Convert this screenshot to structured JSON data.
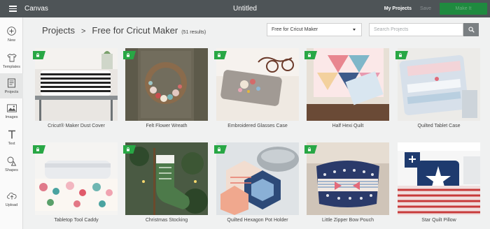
{
  "topbar": {
    "app_title": "Canvas",
    "doc_title": "Untitled",
    "my_projects": "My Projects",
    "save": "Save",
    "make_it": "Make It"
  },
  "sidebar": {
    "items": [
      {
        "label": "New",
        "icon": "plus-icon"
      },
      {
        "label": "Templates",
        "icon": "shirt-icon"
      },
      {
        "label": "Projects",
        "icon": "projects-icon"
      },
      {
        "label": "Images",
        "icon": "image-icon"
      },
      {
        "label": "Text",
        "icon": "text-icon"
      },
      {
        "label": "Shapes",
        "icon": "shapes-icon"
      },
      {
        "label": "Upload",
        "icon": "upload-icon"
      }
    ],
    "active": "Projects"
  },
  "header": {
    "root": "Projects",
    "separator": ">",
    "current": "Free for Cricut Maker",
    "count": "(51 results)"
  },
  "filter": {
    "selected": "Free for Cricut Maker"
  },
  "search": {
    "placeholder": "Search Projects"
  },
  "projects": [
    {
      "name": "Cricut® Maker Dust Cover"
    },
    {
      "name": "Felt Flower Wreath"
    },
    {
      "name": "Embroidered Glasses Case"
    },
    {
      "name": "Half Hexi Quilt"
    },
    {
      "name": "Quilted Tablet Case"
    },
    {
      "name": "Tabletop Tool Caddy"
    },
    {
      "name": "Christmas Stocking"
    },
    {
      "name": "Quilted Hexagon Pot Holder"
    },
    {
      "name": "Little Zipper Bow Pouch"
    },
    {
      "name": "Star Quilt Pillow"
    }
  ],
  "colors": {
    "topbar": "#4e5457",
    "accent_green": "#28a745",
    "make_it": "#1f8a3f"
  }
}
